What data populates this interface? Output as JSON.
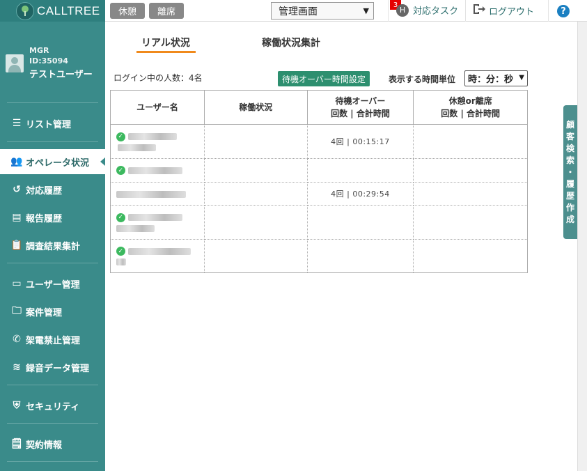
{
  "app": {
    "logo_text": "CALLTREE"
  },
  "topbar": {
    "break_button": "休憩",
    "away_button": "離席",
    "screen_select": "管理画面",
    "task_badge_count": "3",
    "task_avatar_letter": "H",
    "task_label": "対応タスク",
    "logout_label": "ログアウト",
    "help_label": "?"
  },
  "user": {
    "role": "MGR",
    "id": "ID:35094",
    "name": "テストユーザー"
  },
  "sidebar": {
    "items": [
      {
        "label": "リスト管理",
        "icon": "list-icon"
      },
      {
        "label": "オペレータ状況",
        "icon": "operators-icon",
        "active": true
      },
      {
        "label": "対応履歴",
        "icon": "history-icon"
      },
      {
        "label": "報告履歴",
        "icon": "report-icon"
      },
      {
        "label": "調査結果集計",
        "icon": "clipboard-icon"
      },
      {
        "label": "ユーザー管理",
        "icon": "user-card-icon"
      },
      {
        "label": "案件管理",
        "icon": "folder-icon"
      },
      {
        "label": "架電禁止管理",
        "icon": "phone-block-icon"
      },
      {
        "label": "録音データ管理",
        "icon": "sound-wave-icon"
      },
      {
        "label": "セキュリティ",
        "icon": "shield-icon"
      },
      {
        "label": "契約情報",
        "icon": "contract-icon"
      }
    ]
  },
  "tabs": [
    {
      "label": "リアル状況",
      "active": true
    },
    {
      "label": "稼働状況集計"
    }
  ],
  "panel": {
    "login_count": "ログイン中の人数：4名",
    "standby_over_button": "待機オーバー時間設定",
    "unit_label": "表示する時間単位",
    "unit_select": "時：分：秒"
  },
  "table": {
    "headers": {
      "user": "ユーザー名",
      "status": "稼働状況",
      "standby_line1": "待機オーバー",
      "standby_line2": "回数 | 合計時間",
      "break_line1": "休憩or離席",
      "break_line2": "回数 | 合計時間"
    },
    "rows": [
      {
        "online": true,
        "status": "",
        "standby": "4回 | 00:15:17",
        "break": ""
      },
      {
        "online": true,
        "status": "",
        "standby": "",
        "break": ""
      },
      {
        "online": false,
        "status": "",
        "standby": "4回 | 00:29:54",
        "break": ""
      },
      {
        "online": true,
        "status": "",
        "standby": "",
        "break": ""
      },
      {
        "online": true,
        "status": "",
        "standby": "",
        "break": ""
      }
    ]
  },
  "side_tab": {
    "label_chars": [
      "顧",
      "客",
      "検",
      "索",
      "・",
      "履",
      "歴",
      "作",
      "成"
    ]
  },
  "colors": {
    "sidebar": "#3a8b8a",
    "accent_orange": "#f08a1c",
    "button_green": "#2d8f6f",
    "badge_red": "#e40000"
  }
}
